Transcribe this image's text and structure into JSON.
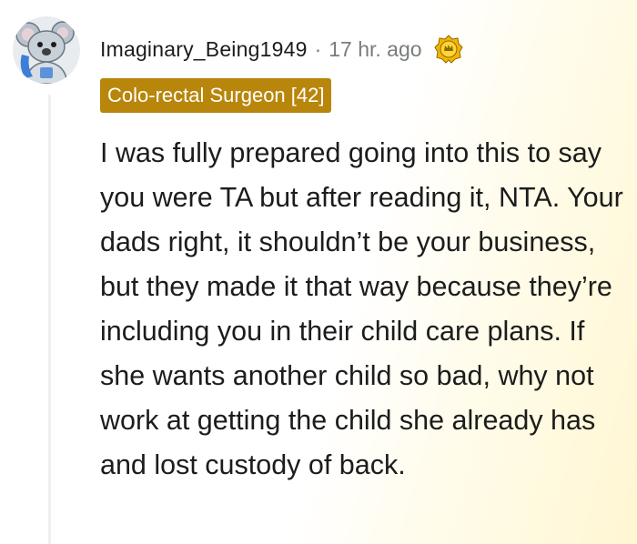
{
  "comment": {
    "username": "Imaginary_Being1949",
    "separator": "·",
    "timestamp": "17 hr. ago",
    "flair": "Colo-rectal Surgeon [42]",
    "award_icon": "gold-award-icon",
    "avatar_icon": "snoo-koala-avatar",
    "body": "I was fully prepared going into this to say you were TA but after reading it, NTA. Your dads right, it shouldn’t be your business, but they made it that way because they’re including you in their child care plans. If she wants another child so bad, why not work at getting the child she already has and lost custody of back."
  },
  "colors": {
    "flair_background": "#b8860b",
    "text": "#1c1c1c",
    "meta": "#787c7e",
    "highlight": "#fff6d2"
  }
}
